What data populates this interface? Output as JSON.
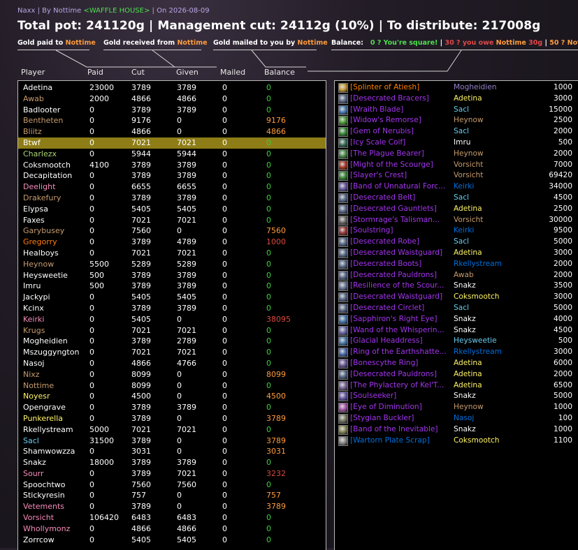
{
  "header": {
    "raid": "Naxx",
    "sep1": " | By ",
    "author": "Nottime",
    "guild": "<WAFFLE HOUSE>",
    "sep2": " | On ",
    "date": "2026-08-09",
    "headline": "Total pot: 241120g | Management cut: 24112g (10%) | To distribute: 217008g"
  },
  "tags": {
    "paid_prefix": "Gold paid to ",
    "received_prefix": "Gold received from ",
    "mailed_prefix": "Gold mailed to you by ",
    "player": "Nottime",
    "balance_label": "Balance:",
    "square": "0 ? You're square!",
    "sepA": " | ",
    "owe_prefix": "30 ? you owe ",
    "owe_amount": "30g",
    "sepB": " | ",
    "owed_prefix": "50 ? Nottime"
  },
  "columns": {
    "player": "Player",
    "paid": "Paid",
    "cut": "Cut",
    "given": "Given",
    "mailed": "Mailed",
    "balance": "Balance"
  },
  "colors": {
    "white": "#ffffff",
    "green": "#3dd03d",
    "orange": "#ff9b3c",
    "red": "#d8483c",
    "priest": "#ffffff",
    "rogue": "#fff468",
    "warlock": "#9482c9",
    "druid": "#ff7c0a",
    "mage": "#69ccf0",
    "hunter": "#abd473",
    "paladin": "#f58cba",
    "shaman": "#0070dd",
    "warrior": "#c69b6d",
    "epic": "#a335ee",
    "legendary": "#ff8000"
  },
  "players": [
    {
      "name": "Adetina",
      "color": "#ffffff",
      "paid": "23000",
      "cut": "3789",
      "given": "3789",
      "mailed": "0",
      "balance": "0",
      "bcolor": "#3dd03d"
    },
    {
      "name": "Awab",
      "color": "#c69b6d",
      "paid": "2000",
      "cut": "4866",
      "given": "4866",
      "mailed": "0",
      "balance": "0",
      "bcolor": "#3dd03d"
    },
    {
      "name": "Badlooter",
      "color": "#ffffff",
      "paid": "0",
      "cut": "3789",
      "given": "3789",
      "mailed": "0",
      "balance": "0",
      "bcolor": "#3dd03d"
    },
    {
      "name": "Bentheten",
      "color": "#c69b6d",
      "paid": "0",
      "cut": "9176",
      "given": "0",
      "mailed": "0",
      "balance": "9176",
      "bcolor": "#ff9b3c"
    },
    {
      "name": "Bliitz",
      "color": "#c69b6d",
      "paid": "0",
      "cut": "4866",
      "given": "0",
      "mailed": "0",
      "balance": "4866",
      "bcolor": "#ff9b3c"
    },
    {
      "name": "Btwf",
      "color": "#ffffff",
      "paid": "0",
      "cut": "7021",
      "given": "7021",
      "mailed": "0",
      "balance": "0",
      "bcolor": "#3dd03d",
      "selected": true
    },
    {
      "name": "Charlezx",
      "color": "#abd473",
      "paid": "0",
      "cut": "5944",
      "given": "5944",
      "mailed": "0",
      "balance": "0",
      "bcolor": "#3dd03d"
    },
    {
      "name": "Coksmootch",
      "color": "#ffffff",
      "paid": "4100",
      "cut": "3789",
      "given": "3789",
      "mailed": "0",
      "balance": "0",
      "bcolor": "#3dd03d"
    },
    {
      "name": "Decapitation",
      "color": "#ffffff",
      "paid": "0",
      "cut": "3789",
      "given": "3789",
      "mailed": "0",
      "balance": "0",
      "bcolor": "#3dd03d"
    },
    {
      "name": "Deelight",
      "color": "#f58cba",
      "paid": "0",
      "cut": "6655",
      "given": "6655",
      "mailed": "0",
      "balance": "0",
      "bcolor": "#3dd03d"
    },
    {
      "name": "Drakefury",
      "color": "#c69b6d",
      "paid": "0",
      "cut": "3789",
      "given": "3789",
      "mailed": "0",
      "balance": "0",
      "bcolor": "#3dd03d"
    },
    {
      "name": "Elypsa",
      "color": "#ffffff",
      "paid": "0",
      "cut": "5405",
      "given": "5405",
      "mailed": "0",
      "balance": "0",
      "bcolor": "#3dd03d"
    },
    {
      "name": "Faxes",
      "color": "#ffffff",
      "paid": "0",
      "cut": "7021",
      "given": "7021",
      "mailed": "0",
      "balance": "0",
      "bcolor": "#3dd03d"
    },
    {
      "name": "Garybusey",
      "color": "#c69b6d",
      "paid": "0",
      "cut": "7560",
      "given": "0",
      "mailed": "0",
      "balance": "7560",
      "bcolor": "#ff9b3c"
    },
    {
      "name": "Gregorry",
      "color": "#ff7c0a",
      "paid": "0",
      "cut": "3789",
      "given": "4789",
      "mailed": "0",
      "balance": "1000",
      "bcolor": "#d8483c"
    },
    {
      "name": "Healboys",
      "color": "#ffffff",
      "paid": "0",
      "cut": "7021",
      "given": "7021",
      "mailed": "0",
      "balance": "0",
      "bcolor": "#3dd03d"
    },
    {
      "name": "Heynow",
      "color": "#c69b6d",
      "paid": "5500",
      "cut": "5289",
      "given": "5289",
      "mailed": "0",
      "balance": "0",
      "bcolor": "#3dd03d"
    },
    {
      "name": "Heysweetie",
      "color": "#ffffff",
      "paid": "500",
      "cut": "3789",
      "given": "3789",
      "mailed": "0",
      "balance": "0",
      "bcolor": "#3dd03d"
    },
    {
      "name": "Imru",
      "color": "#ffffff",
      "paid": "500",
      "cut": "3789",
      "given": "3789",
      "mailed": "0",
      "balance": "0",
      "bcolor": "#3dd03d"
    },
    {
      "name": "Jackypi",
      "color": "#ffffff",
      "paid": "0",
      "cut": "5405",
      "given": "5405",
      "mailed": "0",
      "balance": "0",
      "bcolor": "#3dd03d"
    },
    {
      "name": "Kcinx",
      "color": "#ffffff",
      "paid": "0",
      "cut": "3789",
      "given": "3789",
      "mailed": "0",
      "balance": "0",
      "bcolor": "#3dd03d"
    },
    {
      "name": "Keirki",
      "color": "#f58cba",
      "paid": "0",
      "cut": "5405",
      "given": "0",
      "mailed": "0",
      "balance": "38095",
      "bcolor": "#d8483c"
    },
    {
      "name": "Krugs",
      "color": "#c69b6d",
      "paid": "0",
      "cut": "7021",
      "given": "7021",
      "mailed": "0",
      "balance": "0",
      "bcolor": "#3dd03d"
    },
    {
      "name": "Mogheidien",
      "color": "#ffffff",
      "paid": "0",
      "cut": "3789",
      "given": "2789",
      "mailed": "0",
      "balance": "0",
      "bcolor": "#3dd03d"
    },
    {
      "name": "Mszuggyngton",
      "color": "#ffffff",
      "paid": "0",
      "cut": "7021",
      "given": "7021",
      "mailed": "0",
      "balance": "0",
      "bcolor": "#3dd03d"
    },
    {
      "name": "Nasoj",
      "color": "#ffffff",
      "paid": "0",
      "cut": "4866",
      "given": "4766",
      "mailed": "0",
      "balance": "0",
      "bcolor": "#3dd03d"
    },
    {
      "name": "Nixz",
      "color": "#c69b6d",
      "paid": "0",
      "cut": "8099",
      "given": "0",
      "mailed": "0",
      "balance": "8099",
      "bcolor": "#ff9b3c"
    },
    {
      "name": "Nottime",
      "color": "#c69b6d",
      "paid": "0",
      "cut": "8099",
      "given": "0",
      "mailed": "0",
      "balance": "0",
      "bcolor": "#3dd03d"
    },
    {
      "name": "Noyesr",
      "color": "#fff468",
      "paid": "0",
      "cut": "4500",
      "given": "0",
      "mailed": "0",
      "balance": "4500",
      "bcolor": "#ff9b3c"
    },
    {
      "name": "Opengrave",
      "color": "#ffffff",
      "paid": "0",
      "cut": "3789",
      "given": "3789",
      "mailed": "0",
      "balance": "0",
      "bcolor": "#3dd03d"
    },
    {
      "name": "Punkerella",
      "color": "#fff468",
      "paid": "0",
      "cut": "3789",
      "given": "0",
      "mailed": "0",
      "balance": "3789",
      "bcolor": "#ff9b3c"
    },
    {
      "name": "Rkellystream",
      "color": "#ffffff",
      "paid": "5000",
      "cut": "7021",
      "given": "7021",
      "mailed": "0",
      "balance": "0",
      "bcolor": "#3dd03d"
    },
    {
      "name": "Sacl",
      "color": "#69ccf0",
      "paid": "31500",
      "cut": "3789",
      "given": "0",
      "mailed": "0",
      "balance": "3789",
      "bcolor": "#ff9b3c"
    },
    {
      "name": "Shamwowzza",
      "color": "#ffffff",
      "paid": "0",
      "cut": "3031",
      "given": "0",
      "mailed": "0",
      "balance": "3031",
      "bcolor": "#ff9b3c"
    },
    {
      "name": "Snakz",
      "color": "#ffffff",
      "paid": "18000",
      "cut": "3789",
      "given": "3789",
      "mailed": "0",
      "balance": "0",
      "bcolor": "#3dd03d"
    },
    {
      "name": "Sourr",
      "color": "#f58cba",
      "paid": "0",
      "cut": "3789",
      "given": "7021",
      "mailed": "0",
      "balance": "3232",
      "bcolor": "#d8483c"
    },
    {
      "name": "Spoochtwo",
      "color": "#ffffff",
      "paid": "0",
      "cut": "7560",
      "given": "7560",
      "mailed": "0",
      "balance": "0",
      "bcolor": "#3dd03d"
    },
    {
      "name": "Stickyresin",
      "color": "#ffffff",
      "paid": "0",
      "cut": "757",
      "given": "0",
      "mailed": "0",
      "balance": "757",
      "bcolor": "#ff9b3c"
    },
    {
      "name": "Vetements",
      "color": "#f58cba",
      "paid": "0",
      "cut": "3789",
      "given": "0",
      "mailed": "0",
      "balance": "3789",
      "bcolor": "#ff9b3c"
    },
    {
      "name": "Vorsicht",
      "color": "#f58cba",
      "paid": "106420",
      "cut": "6483",
      "given": "6483",
      "mailed": "0",
      "balance": "0",
      "bcolor": "#3dd03d"
    },
    {
      "name": "Whollymonz",
      "color": "#f58cba",
      "paid": "0",
      "cut": "4866",
      "given": "4866",
      "mailed": "0",
      "balance": "0",
      "bcolor": "#3dd03d"
    },
    {
      "name": "Zorrcow",
      "color": "#ffffff",
      "paid": "0",
      "cut": "5405",
      "given": "5405",
      "mailed": "0",
      "balance": "0",
      "bcolor": "#3dd03d"
    }
  ],
  "items": [
    {
      "name": "[Splinter of Atiesh]",
      "ncolor": "#ff8000",
      "icon": "staff-shard-icon",
      "iconcolor": "#c79c3a",
      "winner": "Mogheidien",
      "wcolor": "#9482c9",
      "gold": "1000"
    },
    {
      "name": "[Desecrated Bracers]",
      "ncolor": "#a335ee",
      "icon": "bracers-icon",
      "iconcolor": "#5a6a8a",
      "winner": "Adetina",
      "wcolor": "#fff468",
      "gold": "3000"
    },
    {
      "name": "[Wraith Blade]",
      "ncolor": "#a335ee",
      "icon": "sword-icon",
      "iconcolor": "#4a7ab0",
      "winner": "Sacl",
      "wcolor": "#69ccf0",
      "gold": "15000"
    },
    {
      "name": "[Widow's Remorse]",
      "ncolor": "#a335ee",
      "icon": "axe-icon",
      "iconcolor": "#4e9a3a",
      "winner": "Heynow",
      "wcolor": "#c69b6d",
      "gold": "2500"
    },
    {
      "name": "[Gem of Nerubis]",
      "ncolor": "#a335ee",
      "icon": "gem-icon",
      "iconcolor": "#3c8a3c",
      "winner": "Sacl",
      "wcolor": "#69ccf0",
      "gold": "2000"
    },
    {
      "name": "[Icy Scale Coif]",
      "ncolor": "#a335ee",
      "icon": "helm-icon",
      "iconcolor": "#3a6a5a",
      "winner": "Imru",
      "wcolor": "#ffffff",
      "gold": "500"
    },
    {
      "name": "[The Plague Bearer]",
      "ncolor": "#a335ee",
      "icon": "shield-icon",
      "iconcolor": "#4a8a4a",
      "winner": "Heynow",
      "wcolor": "#c69b6d",
      "gold": "2000"
    },
    {
      "name": "[Might of the Scourge]",
      "ncolor": "#a335ee",
      "icon": "shoulder-icon",
      "iconcolor": "#a83a2a",
      "winner": "Vorsicht",
      "wcolor": "#c69b6d",
      "gold": "7000"
    },
    {
      "name": "[Slayer's Crest]",
      "ncolor": "#a335ee",
      "icon": "trinket-icon",
      "iconcolor": "#3a8a3a",
      "winner": "Vorsicht",
      "wcolor": "#c69b6d",
      "gold": "69420"
    },
    {
      "name": "[Band of Unnatural Forc...",
      "ncolor": "#a335ee",
      "icon": "ring-icon",
      "iconcolor": "#6a5aa0",
      "winner": "Keirki",
      "wcolor": "#0070dd",
      "gold": "34000"
    },
    {
      "name": "[Desecrated Belt]",
      "ncolor": "#a335ee",
      "icon": "belt-icon",
      "iconcolor": "#5a6a8a",
      "winner": "Sacl",
      "wcolor": "#69ccf0",
      "gold": "4500"
    },
    {
      "name": "[Desecrated Gauntlets]",
      "ncolor": "#a335ee",
      "icon": "gloves-icon",
      "iconcolor": "#5a6a8a",
      "winner": "Adetina",
      "wcolor": "#fff468",
      "gold": "2500"
    },
    {
      "name": "[Stormrage's Talisman...",
      "ncolor": "#a335ee",
      "icon": "talisman-icon",
      "iconcolor": "#6a6a6a",
      "winner": "Vorsicht",
      "wcolor": "#c69b6d",
      "gold": "30000"
    },
    {
      "name": "[Soulstring]",
      "ncolor": "#a335ee",
      "icon": "bow-icon",
      "iconcolor": "#9a3a3a",
      "winner": "Keirki",
      "wcolor": "#0070dd",
      "gold": "9500"
    },
    {
      "name": "[Desecrated Robe]",
      "ncolor": "#a335ee",
      "icon": "robe-icon",
      "iconcolor": "#5a6a8a",
      "winner": "Sacl",
      "wcolor": "#69ccf0",
      "gold": "5000"
    },
    {
      "name": "[Desecrated Waistguard]",
      "ncolor": "#a335ee",
      "icon": "belt-icon",
      "iconcolor": "#5a6a8a",
      "winner": "Adetina",
      "wcolor": "#fff468",
      "gold": "3000"
    },
    {
      "name": "[Desecrated Boots]",
      "ncolor": "#a335ee",
      "icon": "boots-icon",
      "iconcolor": "#5a6a8a",
      "winner": "Rkellystream",
      "wcolor": "#0070dd",
      "gold": "2000"
    },
    {
      "name": "[Desecrated Pauldrons]",
      "ncolor": "#a335ee",
      "icon": "shoulder-icon",
      "iconcolor": "#5a6a8a",
      "winner": "Awab",
      "wcolor": "#c69b6d",
      "gold": "2000"
    },
    {
      "name": "[Resilience of the Scour...",
      "ncolor": "#a335ee",
      "icon": "shoulder-icon",
      "iconcolor": "#6a7a9a",
      "winner": "Snakz",
      "wcolor": "#ffffff",
      "gold": "3500"
    },
    {
      "name": "[Desecrated Waistguard]",
      "ncolor": "#a335ee",
      "icon": "belt-icon",
      "iconcolor": "#5a6a8a",
      "winner": "Coksmootch",
      "wcolor": "#fff468",
      "gold": "3000"
    },
    {
      "name": "[Desecrated Circlet]",
      "ncolor": "#a335ee",
      "icon": "helm-icon",
      "iconcolor": "#5a6a8a",
      "winner": "Sacl",
      "wcolor": "#69ccf0",
      "gold": "5000"
    },
    {
      "name": "[Sapphiron's Right Eye]",
      "ncolor": "#a335ee",
      "icon": "dagger-icon",
      "iconcolor": "#4a7ab0",
      "winner": "Snakz",
      "wcolor": "#ffffff",
      "gold": "4000"
    },
    {
      "name": "[Wand of the Whisperin...",
      "ncolor": "#a335ee",
      "icon": "wand-icon",
      "iconcolor": "#6a6aaa",
      "winner": "Snakz",
      "wcolor": "#ffffff",
      "gold": "4500"
    },
    {
      "name": "[Glacial Headdress]",
      "ncolor": "#a335ee",
      "icon": "helm-icon",
      "iconcolor": "#4a7aaa",
      "winner": "Heysweetie",
      "wcolor": "#69ccf0",
      "gold": "500"
    },
    {
      "name": "[Ring of the Earthshatte...",
      "ncolor": "#a335ee",
      "icon": "ring-icon",
      "iconcolor": "#4a6aaa",
      "winner": "Rkellystream",
      "wcolor": "#0070dd",
      "gold": "3000"
    },
    {
      "name": "[Bonescythe Ring]",
      "ncolor": "#a335ee",
      "icon": "ring-icon",
      "iconcolor": "#6a5a9a",
      "winner": "Adetina",
      "wcolor": "#fff468",
      "gold": "6000"
    },
    {
      "name": "[Desecrated Pauldrons]",
      "ncolor": "#a335ee",
      "icon": "shoulder-icon",
      "iconcolor": "#5a6a8a",
      "winner": "Adetina",
      "wcolor": "#fff468",
      "gold": "2000"
    },
    {
      "name": "[The Phylactery of Kel'T...",
      "ncolor": "#a335ee",
      "icon": "phylactery-icon",
      "iconcolor": "#7a6a9a",
      "winner": "Adetina",
      "wcolor": "#fff468",
      "gold": "6500"
    },
    {
      "name": "[Soulseeker]",
      "ncolor": "#a335ee",
      "icon": "staff-icon",
      "iconcolor": "#6a5aaa",
      "winner": "Snakz",
      "wcolor": "#ffffff",
      "gold": "5000"
    },
    {
      "name": "[Eye of Diminution]",
      "ncolor": "#a335ee",
      "icon": "eye-trinket-icon",
      "iconcolor": "#aa5aaa",
      "winner": "Heynow",
      "wcolor": "#c69b6d",
      "gold": "1000"
    },
    {
      "name": "[Stygian Buckler]",
      "ncolor": "#a335ee",
      "icon": "buckler-icon",
      "iconcolor": "#7a7a6a",
      "winner": "Nasoj",
      "wcolor": "#0070dd",
      "gold": "100"
    },
    {
      "name": "[Band of the Inevitable]",
      "ncolor": "#a335ee",
      "icon": "ring-icon",
      "iconcolor": "#8a8a5a",
      "winner": "Snakz",
      "wcolor": "#ffffff",
      "gold": "1000"
    },
    {
      "name": "[Wartorn Plate Scrap]",
      "ncolor": "#0070dd",
      "icon": "plate-scrap-icon",
      "iconcolor": "#8a8a8a",
      "winner": "Coksmootch",
      "wcolor": "#fff468",
      "gold": "1100"
    }
  ]
}
